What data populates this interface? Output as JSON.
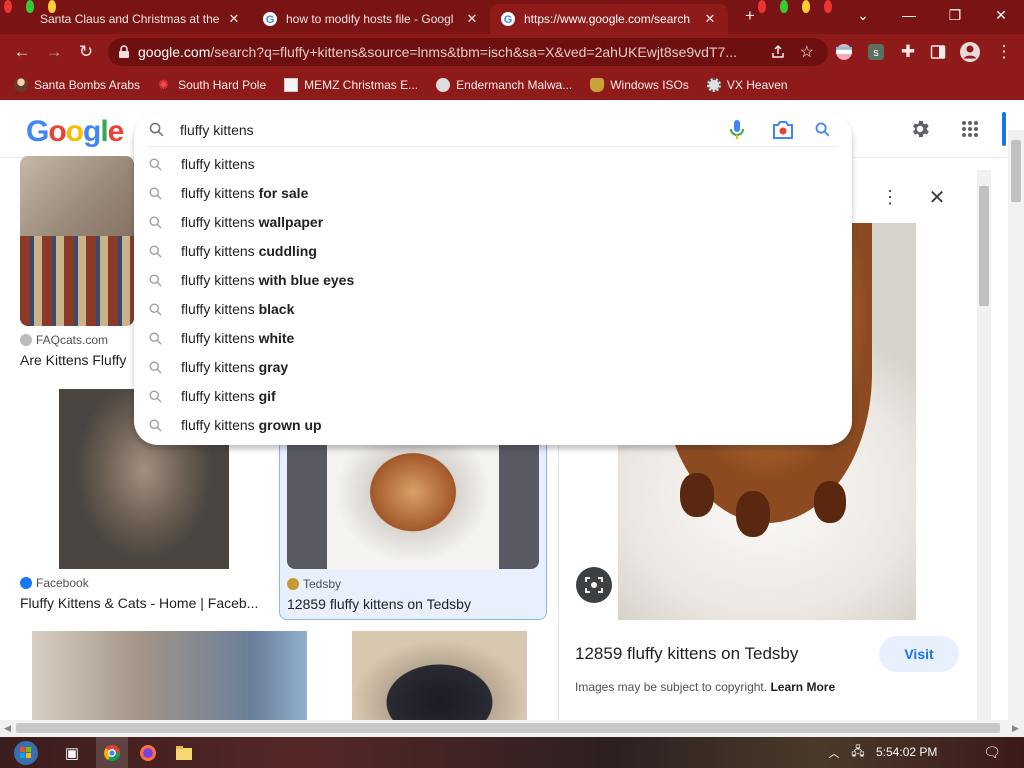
{
  "browser": {
    "tabs": [
      {
        "title": "Santa Claus and Christmas at the",
        "active": false
      },
      {
        "title": "how to modify hosts file - Googl",
        "active": false
      },
      {
        "title": "https://www.google.com/search",
        "active": true
      }
    ],
    "url_host": "google.com",
    "url_rest": "/search?q=fluffy+kittens&source=lnms&tbm=isch&sa=X&ved=2ahUKEwjt8se9vdT7...",
    "bookmarks": [
      "Santa Bombs Arabs",
      "South Hard Pole",
      "MEMZ Christmas E...",
      "Endermanch Malwa...",
      "Windows ISOs",
      "VX Heaven"
    ]
  },
  "search": {
    "logo": [
      "G",
      "o",
      "o",
      "g",
      "l",
      "e"
    ],
    "query": "fluffy kittens",
    "suggestions": [
      {
        "prefix": "fluffy kittens",
        "bold": ""
      },
      {
        "prefix": "fluffy kittens ",
        "bold": "for sale"
      },
      {
        "prefix": "fluffy kittens ",
        "bold": "wallpaper"
      },
      {
        "prefix": "fluffy kittens ",
        "bold": "cuddling"
      },
      {
        "prefix": "fluffy kittens ",
        "bold": "with blue eyes"
      },
      {
        "prefix": "fluffy kittens ",
        "bold": "black"
      },
      {
        "prefix": "fluffy kittens ",
        "bold": "white"
      },
      {
        "prefix": "fluffy kittens ",
        "bold": "gray"
      },
      {
        "prefix": "fluffy kittens ",
        "bold": "gif"
      },
      {
        "prefix": "fluffy kittens ",
        "bold": "grown up"
      }
    ]
  },
  "results": [
    {
      "source": "FAQcats.com",
      "title": "Are Kittens Fluffy"
    },
    {
      "source": "Facebook",
      "title": "Fluffy Kittens & Cats - Home | Faceb..."
    },
    {
      "source": "Tedsby",
      "title": "12859 fluffy kittens on Tedsby"
    }
  ],
  "side_panel": {
    "title": "12859 fluffy kittens on Tedsby",
    "visit": "Visit",
    "copyright": "Images may be subject to copyright.",
    "learn_more": "Learn More"
  },
  "taskbar": {
    "clock": "5:54:02 PM"
  },
  "colors": {
    "chrome_bg": "#8e1a1a",
    "tabstrip_bg": "#7a1313",
    "accent_blue": "#1a73e8"
  }
}
